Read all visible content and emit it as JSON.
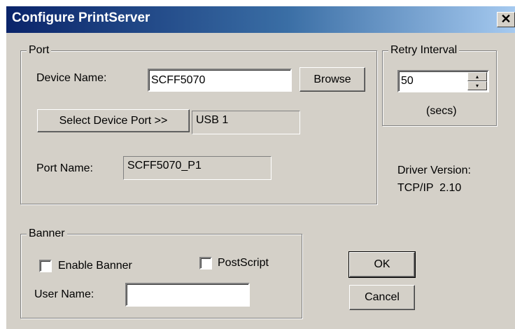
{
  "window": {
    "title": "Configure PrintServer",
    "close_glyph": "✕"
  },
  "port": {
    "legend": "Port",
    "device_name_label": "Device Name:",
    "device_name_value": "SCFF5070",
    "browse_label": "Browse",
    "select_port_label": "Select Device Port >>",
    "selected_port_value": "USB 1",
    "port_name_label": "Port Name:",
    "port_name_value": "SCFF5070_P1"
  },
  "retry": {
    "legend": "Retry Interval",
    "value": "50",
    "unit": "(secs)",
    "up_glyph": "▴",
    "down_glyph": "▾"
  },
  "driver": {
    "version_label": "Driver Version:",
    "version_value": "TCP/IP  2.10"
  },
  "banner": {
    "legend": "Banner",
    "enable_label": "Enable Banner",
    "enable_checked": false,
    "postscript_label": "PostScript",
    "postscript_checked": false,
    "user_name_label": "User Name:",
    "user_name_value": ""
  },
  "actions": {
    "ok_label": "OK",
    "cancel_label": "Cancel"
  },
  "colors": {
    "title_start": "#0a246a",
    "title_end": "#a6caf0",
    "face": "#d4d0c8"
  },
  "icons": {
    "close": "close-icon",
    "spin_up": "spin-up-icon",
    "spin_down": "spin-down-icon"
  }
}
